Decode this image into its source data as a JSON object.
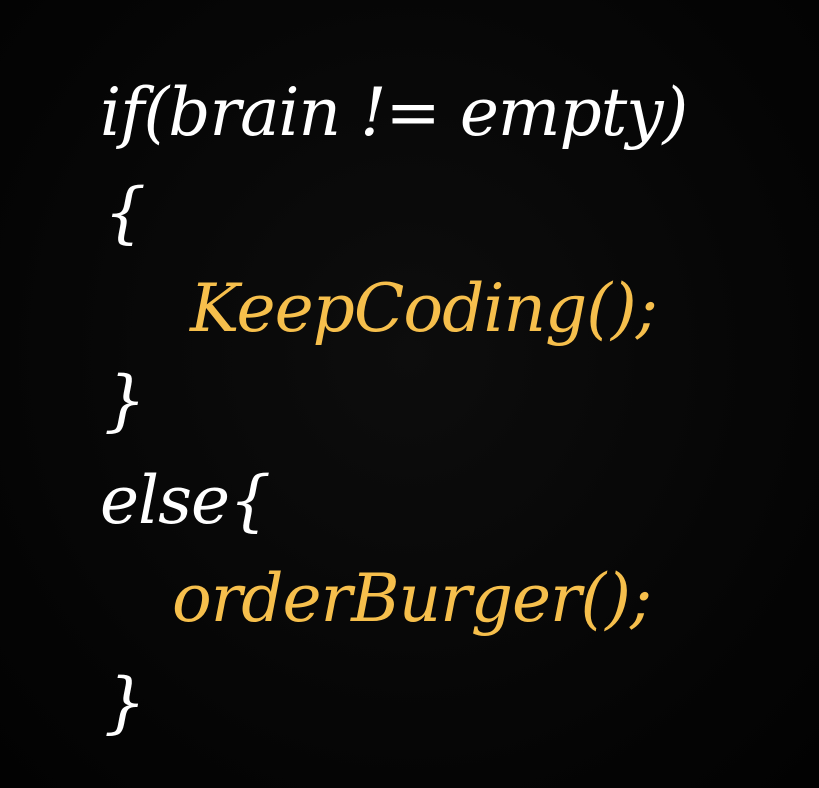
{
  "lines": [
    {
      "text": "if(brain != empty)",
      "color": "#ffffff"
    },
    {
      "text": "{",
      "color": "#ffffff"
    },
    {
      "text": "KeepCoding();",
      "color": "#f6bf4c"
    },
    {
      "text": "}",
      "color": "#ffffff"
    },
    {
      "text": "else{",
      "color": "#ffffff"
    },
    {
      "text": "orderBurger();",
      "color": "#f6bf4c"
    },
    {
      "text": "}",
      "color": "#ffffff"
    }
  ],
  "colors": {
    "background": "#050505",
    "primary_text": "#ffffff",
    "accent_text": "#f6bf4c"
  }
}
